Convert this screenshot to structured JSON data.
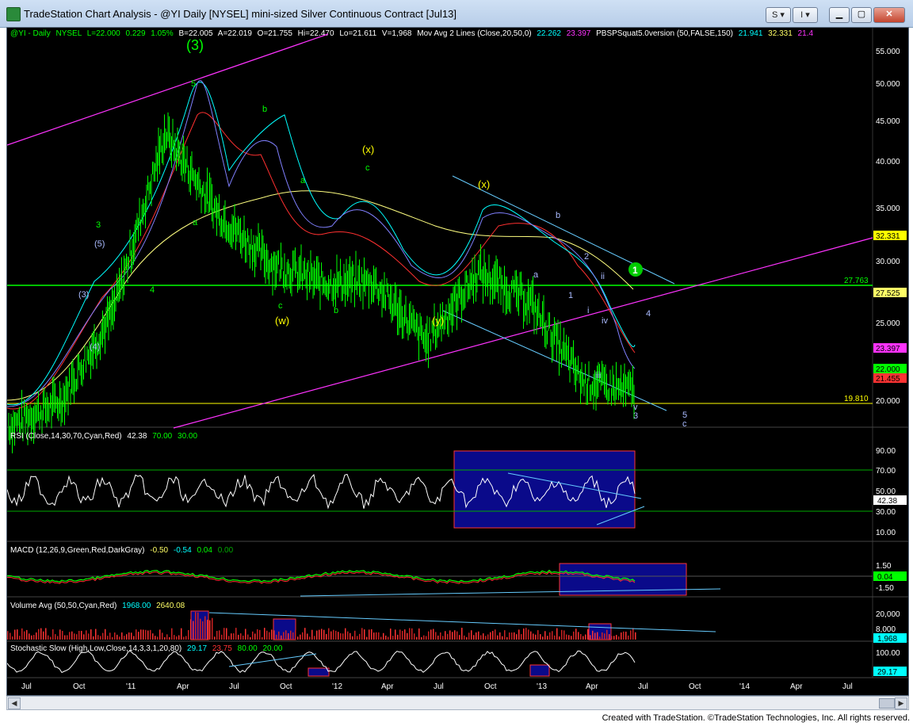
{
  "window": {
    "title": "TradeStation Chart Analysis - @YI Daily [NYSEL] mini-sized Silver Continuous Contract [Jul13]",
    "buttons": {
      "s_label": "S",
      "i_label": "I"
    }
  },
  "footer": {
    "text": "Created with TradeStation. ©TradeStation Technologies, Inc. All rights reserved."
  },
  "colors": {
    "background": "#000000",
    "price_bars": "#00ff00",
    "ma20": "#00ffff",
    "ma50": "#ff0000",
    "ma150": "#ffff80",
    "channel": "#ff33ff",
    "trendline": "#66ccff",
    "support_line": "#ffff00",
    "resistance_line": "#00ff00",
    "highlight_box": "#0a0a8a"
  },
  "chart": {
    "info_line": {
      "symbol": "@YI - Daily",
      "exchange": "NYSEL",
      "last": "L=22.000",
      "change": "0.229",
      "pct": "1.05%",
      "bid": "B=22.005",
      "ask": "A=22.019",
      "open": "O=21.755",
      "high": "Hi=22.470",
      "low": "Lo=21.611",
      "volume": "V=1,968",
      "mov_avg_label": "Mov Avg 2 Lines (Close,20,50,0)",
      "ma20_value": "22.262",
      "ma50_value": "23.397",
      "pbs_label": "PBSPSquat5.0version (50,FALSE,150)",
      "pbs_value1": "21.941",
      "pbs_value2": "32.331",
      "pbs_value3": "21.4"
    },
    "price_axis_ticks": [
      "55.000",
      "50.000",
      "45.000",
      "40.000",
      "35.000",
      "30.000",
      "25.000",
      "20.000"
    ],
    "price_axis_marks": [
      {
        "label": "32.331",
        "color": "#ffff00",
        "text_color": "#000000"
      },
      {
        "label": "27.525",
        "color": "#ffff66",
        "text_color": "#000000"
      },
      {
        "label": "23.397",
        "color": "#ff33ff",
        "text_color": "#000000"
      },
      {
        "label": "22.000",
        "color": "#00ff00",
        "text_color": "#000000"
      },
      {
        "label": "21.455",
        "color": "#ff3333",
        "text_color": "#000000"
      }
    ],
    "level_labels": {
      "resistance": "27.763",
      "support": "19.810"
    },
    "wave_labels": [
      {
        "text": "(3)",
        "color": "#00ff00"
      },
      {
        "text": "5",
        "color": "#00ff00"
      },
      {
        "text": "3",
        "color": "#00ff00"
      },
      {
        "text": "(5)",
        "color": "#aabbff"
      },
      {
        "text": "(3)",
        "color": "#aabbff"
      },
      {
        "text": "(4)",
        "color": "#aabbff"
      },
      {
        "text": "4",
        "color": "#00ff00"
      },
      {
        "text": "a",
        "color": "#00ff00"
      },
      {
        "text": "b",
        "color": "#00ff00"
      },
      {
        "text": "a",
        "color": "#00ff00"
      },
      {
        "text": "c",
        "color": "#00ff00"
      },
      {
        "text": "(w)",
        "color": "#ffff00"
      },
      {
        "text": "b",
        "color": "#00ff00"
      },
      {
        "text": "(x)",
        "color": "#ffff00"
      },
      {
        "text": "c",
        "color": "#00ff00"
      },
      {
        "text": "(y)",
        "color": "#ffff00"
      },
      {
        "text": "(x)",
        "color": "#ffff00"
      },
      {
        "text": "b",
        "color": "#aabbff"
      },
      {
        "text": "a",
        "color": "#aabbff"
      },
      {
        "text": "2",
        "color": "#aabbff"
      },
      {
        "text": "1",
        "color": "#aabbff"
      },
      {
        "text": "ii",
        "color": "#aabbff"
      },
      {
        "text": "i",
        "color": "#aabbff"
      },
      {
        "text": "iv",
        "color": "#aabbff"
      },
      {
        "text": "iii",
        "color": "#aabbff"
      },
      {
        "text": "v",
        "color": "#aabbff"
      },
      {
        "text": "3",
        "color": "#aabbff"
      },
      {
        "text": "4",
        "color": "#aabbff"
      },
      {
        "text": "5",
        "color": "#aabbff"
      },
      {
        "text": "c",
        "color": "#aabbff"
      }
    ],
    "circled_label": "1"
  },
  "panes": {
    "rsi": {
      "label": "RSI (Close,14,30,70,Cyan,Red)",
      "value": "42.38",
      "ob": "70.00",
      "os": "30.00",
      "ticks": [
        "90.00",
        "70.00",
        "50.00",
        "30.00",
        "10.00"
      ],
      "axis_value": "42.38"
    },
    "macd": {
      "label": "MACD (12,26,9,Green,Red,DarkGray)",
      "v1": "-0.50",
      "v2": "-0.54",
      "v3": "0.04",
      "v4": "0.00",
      "ticks": [
        "1.50",
        "-1.50"
      ],
      "axis_value": "0.04"
    },
    "volume": {
      "label": "Volume Avg (50,50,Cyan,Red)",
      "v1": "1968.00",
      "v2": "2640.08",
      "ticks": [
        "20,000",
        "8,000"
      ],
      "axis_value": "1,968"
    },
    "stochastic": {
      "label": "Stochastic Slow (High,Low,Close,14,3,3,1,20,80)",
      "v1": "29.17",
      "v2": "23.75",
      "v3": "80.00",
      "v4": "20.00",
      "ticks": [
        "100.00"
      ],
      "axis_value": "29.17"
    }
  },
  "x_axis_labels": [
    "Jul",
    "Oct",
    "'11",
    "Apr",
    "Jul",
    "Oct",
    "'12",
    "Apr",
    "Jul",
    "Oct",
    "'13",
    "Apr",
    "Jul",
    "Oct",
    "'14",
    "Apr",
    "Jul"
  ],
  "chart_data": {
    "type": "bar",
    "xlabel": "",
    "ylabel": "",
    "ylim": [
      18.5,
      57.5
    ],
    "x": [
      "2010-07",
      "2010-10",
      "2011-01",
      "2011-04",
      "2011-07",
      "2011-10",
      "2012-01",
      "2012-04",
      "2012-07",
      "2012-10",
      "2013-01",
      "2013-04",
      "2013-06"
    ],
    "series": [
      {
        "values": [
          18.5,
          21,
          30,
          48,
          40,
          35,
          33,
          33,
          27,
          34,
          31,
          23,
          22
        ]
      }
    ],
    "horizontal_lines": [
      27.763,
      19.81
    ],
    "grid": false,
    "legend": "none"
  }
}
